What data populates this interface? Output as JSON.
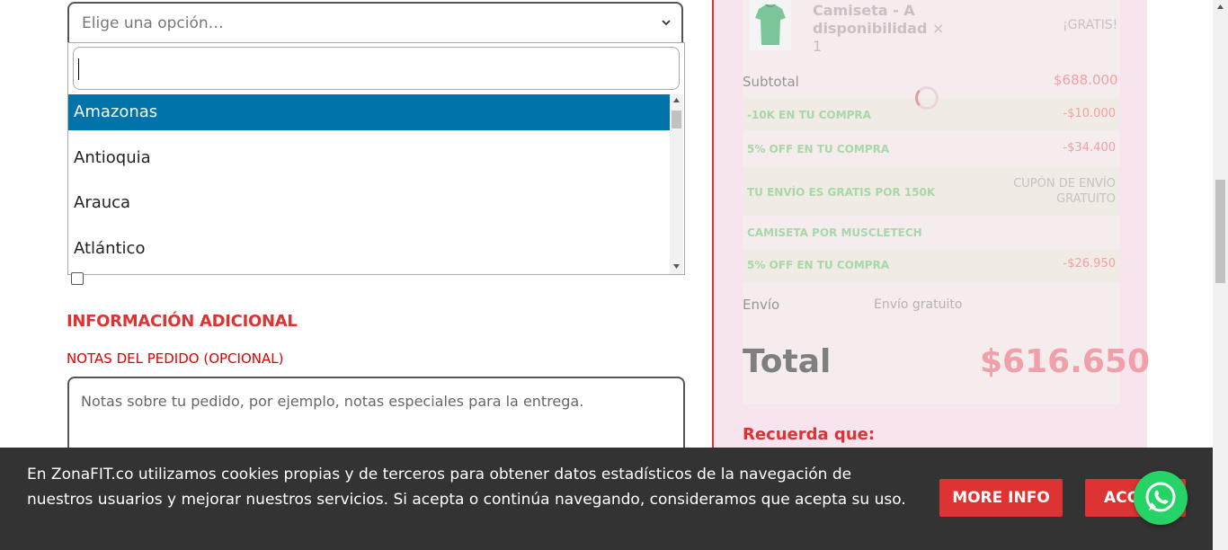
{
  "select": {
    "placeholder": "Elige una opción…",
    "search_value": "",
    "options": [
      "Amazonas",
      "Antioquia",
      "Arauca",
      "Atlántico"
    ],
    "selected": "Amazonas"
  },
  "additional": {
    "section_title": "INFORMACIÓN ADICIONAL",
    "notes_label": "NOTAS DEL PEDIDO (OPCIONAL)",
    "notes_placeholder": "Notas sobre tu pedido, por ejemplo, notas especiales para la entrega."
  },
  "order": {
    "product_name": "Camiseta - A disponibilidad",
    "product_qty": "× 1",
    "product_price": "¡GRATIS!",
    "subtotal_label": "Subtotal",
    "subtotal_value": "$688.000",
    "discounts": [
      {
        "label": "-10K EN TU COMPRA",
        "value": "-$10.000"
      },
      {
        "label": "5% OFF EN TU COMPRA",
        "value": "-$34.400"
      },
      {
        "label": "TU ENVÍO ES GRATIS POR 150K",
        "value": "CUPÓN DE ENVÍO GRATUITO"
      },
      {
        "label": "CAMISETA POR MUSCLETECH",
        "value": ""
      },
      {
        "label": "5% OFF EN TU COMPRA",
        "value": "-$26.950"
      }
    ],
    "shipping_label": "Envío",
    "shipping_value": "Envío gratuito",
    "total_label": "Total",
    "total_value": "$616.650",
    "reminder_title": "Recuerda que:"
  },
  "cookie": {
    "text": "En ZonaFIT.co utilizamos cookies propias y de terceros para obtener datos estadísticos de la navegación de nuestros usuarios y mejorar nuestros servicios. Si acepta o continúa navegando, consideramos que acepta su uso.",
    "more_info_label": "MORE INFO",
    "accept_label": "ACCEPT"
  },
  "colors": {
    "accent_red": "#dd3333",
    "select_highlight": "#0073aa",
    "whatsapp_green": "#25d366"
  },
  "icons": {
    "chevron": "chevron-down-icon",
    "whatsapp": "whatsapp-icon"
  }
}
